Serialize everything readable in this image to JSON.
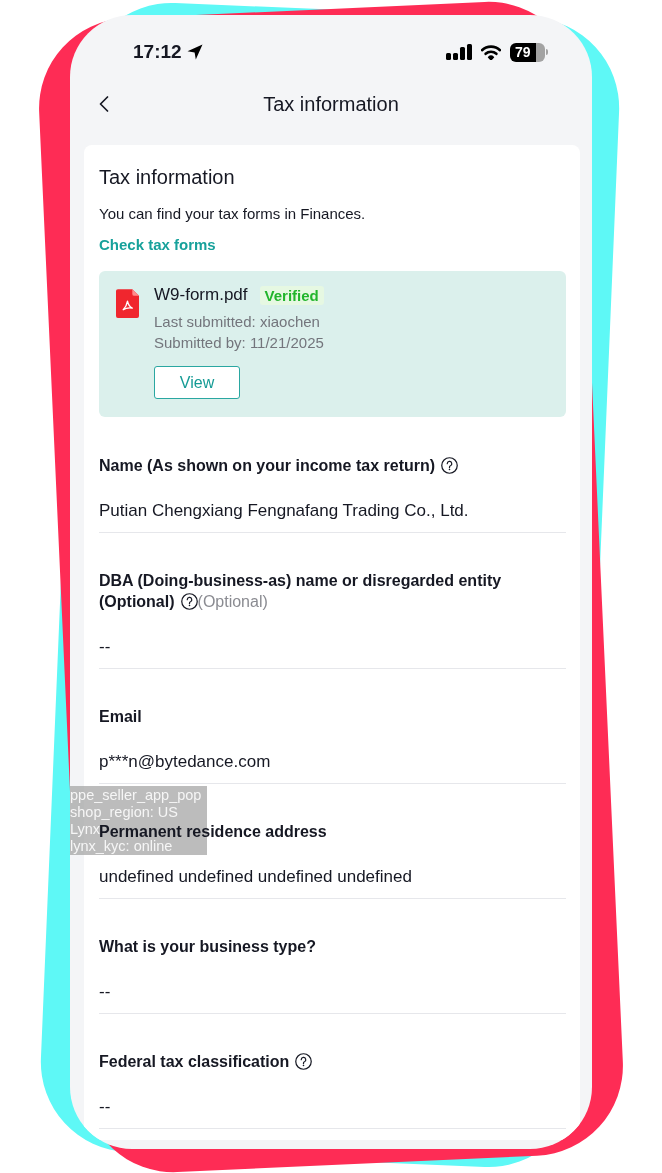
{
  "status_bar": {
    "time": "17:12",
    "battery": "79"
  },
  "header": {
    "title": "Tax information"
  },
  "tax_card": {
    "title": "Tax information",
    "description": "You can find your tax forms in Finances.",
    "link": "Check tax forms",
    "document": {
      "file_name": "W9-form.pdf",
      "status": "Verified",
      "details": [
        "Last submitted: xiaochen",
        "Submitted by: 11/21/2025"
      ],
      "button": "View"
    }
  },
  "fields": [
    {
      "label": "Name (As shown on your income tax return)",
      "help": true,
      "value": "Putian Chengxiang Fengnafang Trading Co., Ltd."
    },
    {
      "label": "DBA (Doing-business-as) name or disregarded entity",
      "label_note": "(Optional)",
      "help": true,
      "hint": "(Optional)",
      "value": "--"
    },
    {
      "label": "Email",
      "help": false,
      "value": "p***n@bytedance.com"
    },
    {
      "label": "Permanent residence address",
      "help": false,
      "value": "undefined undefined undefined undefined"
    },
    {
      "label": "What is your business type?",
      "help": false,
      "value": "--"
    },
    {
      "label": "Federal tax classification",
      "help": true,
      "value": "--"
    }
  ],
  "debug_overlay": {
    "lines": [
      "ppe_seller_app_pop",
      "shop_region: US",
      "Lynx",
      "lynx_kyc: online"
    ]
  }
}
